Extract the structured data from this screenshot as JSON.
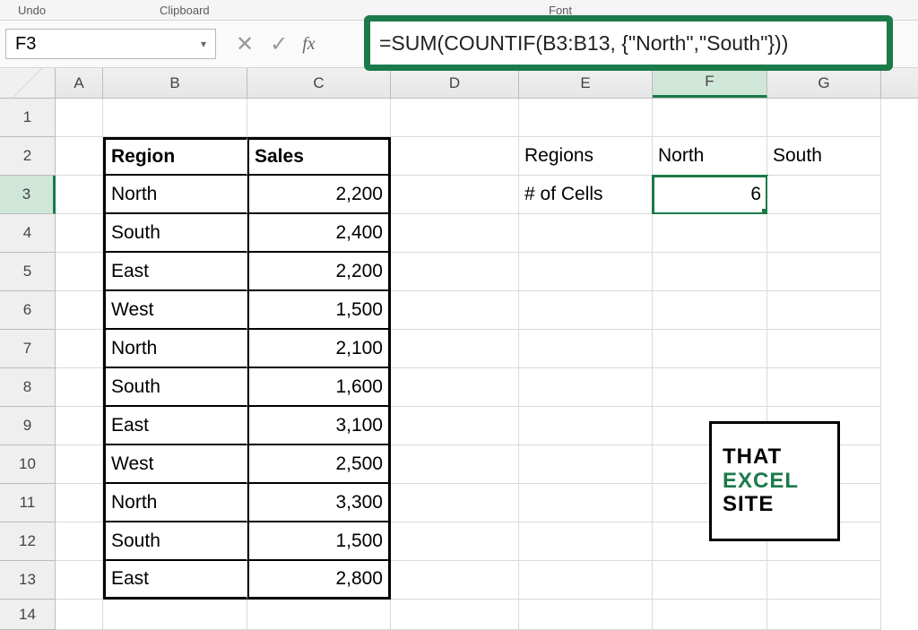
{
  "ribbon": {
    "undo": "Undo",
    "clipboard": "Clipboard",
    "font": "Font"
  },
  "nameBox": "F3",
  "formula": "=SUM(COUNTIF(B3:B13, {\"North\",\"South\"}))",
  "columns": [
    "A",
    "B",
    "C",
    "D",
    "E",
    "F",
    "G"
  ],
  "rowLabels": [
    "1",
    "2",
    "3",
    "4",
    "5",
    "6",
    "7",
    "8",
    "9",
    "10",
    "11",
    "12",
    "13",
    "14"
  ],
  "selectedCol": "F",
  "selectedRow": "3",
  "headers": {
    "region": "Region",
    "sales": "Sales"
  },
  "tableRows": [
    {
      "region": "North",
      "sales": "2,200"
    },
    {
      "region": "South",
      "sales": "2,400"
    },
    {
      "region": "East",
      "sales": "2,200"
    },
    {
      "region": "West",
      "sales": "1,500"
    },
    {
      "region": "North",
      "sales": "2,100"
    },
    {
      "region": "South",
      "sales": "1,600"
    },
    {
      "region": "East",
      "sales": "3,100"
    },
    {
      "region": "West",
      "sales": "2,500"
    },
    {
      "region": "North",
      "sales": "3,300"
    },
    {
      "region": "South",
      "sales": "1,500"
    },
    {
      "region": "East",
      "sales": "2,800"
    }
  ],
  "side": {
    "regionsLabel": "Regions",
    "cellsLabel": "# of Cells",
    "f2": "North",
    "g2": "South",
    "f3": "6"
  },
  "watermark": {
    "l1": "THAT",
    "l2": "EXCEL",
    "l3": "SITE"
  }
}
